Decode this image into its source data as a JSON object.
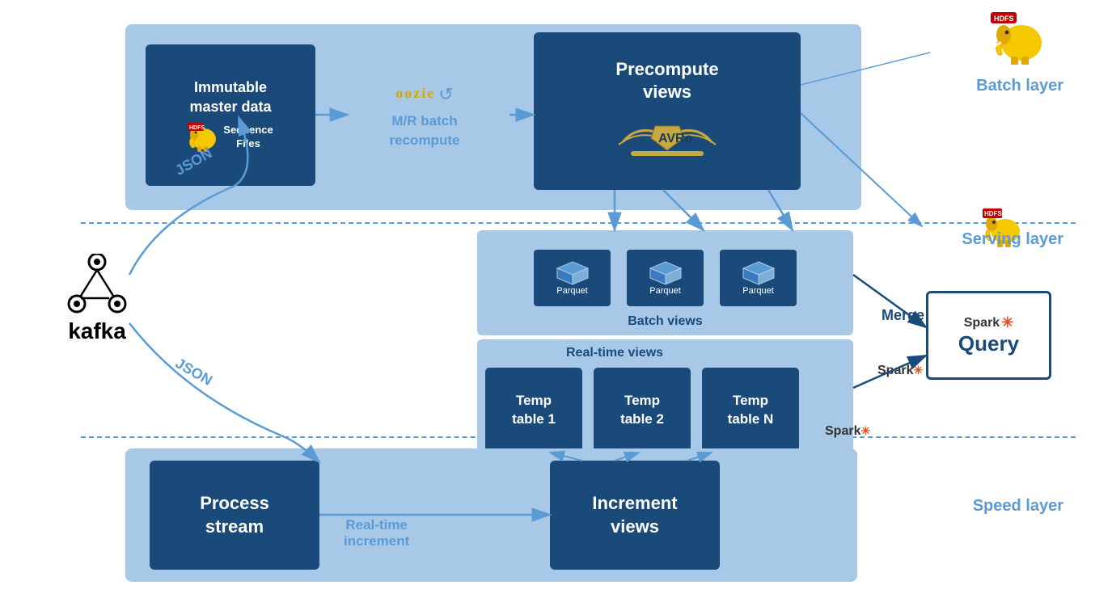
{
  "layers": {
    "batch": {
      "label": "Batch layer",
      "master_data_title": "Immutable\nmaster data",
      "sequence_files": "Sequence\nFiles",
      "hdfs_label": "HDFS",
      "oozie_label": "oozie",
      "mr_batch": "M/R batch\nrecompute",
      "precompute_title": "Precompute\nviews",
      "avro_label": "AVRo"
    },
    "serving": {
      "label": "Serving layer",
      "batch_views_label": "Batch views",
      "parquet_label": "Parquet"
    },
    "speed": {
      "label": "Speed layer",
      "process_stream": "Process\nstream",
      "increment_views": "Increment\nviews",
      "realtime_increment": "Real-time\nincrement"
    },
    "realtime_views": {
      "label": "Real-time views",
      "temp1": "Temp\ntable 1",
      "temp2": "Temp\ntable 2",
      "tempN": "Temp\ntable N"
    }
  },
  "components": {
    "kafka": "kafka",
    "json_label": "JSON",
    "merge_label": "Merge",
    "spark_query": "Query",
    "spark_label": "Spark"
  }
}
